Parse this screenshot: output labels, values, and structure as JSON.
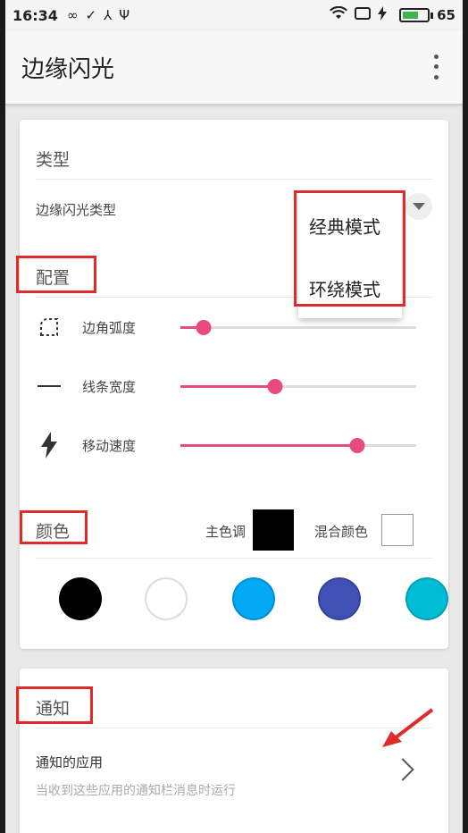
{
  "status_bar": {
    "time": "16:34",
    "battery": "65",
    "icons": [
      "infinity-icon",
      "check-circle-icon",
      "share-icon",
      "usb-icon",
      "wifi-icon",
      "screen-icon",
      "charging-icon",
      "battery-icon"
    ]
  },
  "app_bar": {
    "title": "边缘闪光",
    "menu_icon": "more-vert-icon"
  },
  "type_section": {
    "header": "类型",
    "row_label": "边缘闪光类型",
    "dropdown_options": [
      "经典模式",
      "环绕模式"
    ]
  },
  "config_section": {
    "header": "配置",
    "sliders": [
      {
        "label": "边角弧度",
        "icon": "rounded-corner-icon",
        "value": 0.1
      },
      {
        "label": "线条宽度",
        "icon": "line-width-icon",
        "value": 0.4
      },
      {
        "label": "移动速度",
        "icon": "speed-bolt-icon",
        "value": 0.75
      }
    ]
  },
  "color_section": {
    "header": "颜色",
    "main_label": "主色调",
    "main_color": "#000000",
    "mix_label": "混合颜色",
    "mix_color": "#ffffff",
    "swatches": [
      "#000000",
      "#ffffff",
      "#03a9f4",
      "#3f51b5",
      "#00bcd4"
    ]
  },
  "notify_section": {
    "header": "通知",
    "title": "通知的应用",
    "subtitle": "当收到这些应用的通知栏消息时运行"
  },
  "colors": {
    "accent": "#e94a7f",
    "annotation": "#e02b2b"
  }
}
